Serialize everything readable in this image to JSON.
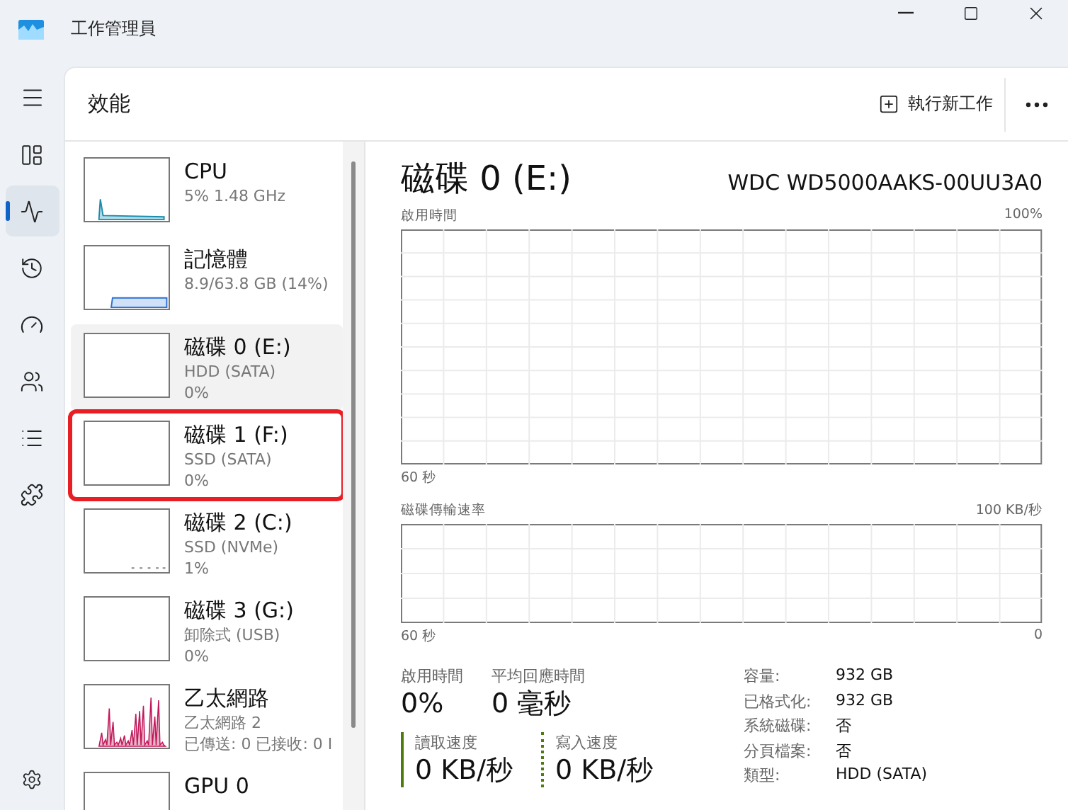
{
  "window": {
    "title": "工作管理員"
  },
  "nav": [
    {
      "kind": "processes",
      "selected": false
    },
    {
      "kind": "performance",
      "selected": true
    },
    {
      "kind": "history",
      "selected": false
    },
    {
      "kind": "startup",
      "selected": false
    },
    {
      "kind": "users",
      "selected": false
    },
    {
      "kind": "details",
      "selected": false
    },
    {
      "kind": "services",
      "selected": false
    }
  ],
  "header": {
    "title": "效能",
    "run_task": "執行新工作"
  },
  "devices": [
    {
      "kind": "cpu",
      "name": "CPU",
      "line1": "5% 1.48 GHz",
      "selected": false,
      "highlighted": false
    },
    {
      "kind": "memory",
      "name": "記憶體",
      "line1": "8.9/63.8 GB (14%)",
      "selected": false,
      "highlighted": false
    },
    {
      "kind": "disk",
      "name": "磁碟 0 (E:)",
      "line1": "HDD (SATA)",
      "line2": "0%",
      "selected": true,
      "highlighted": false
    },
    {
      "kind": "disk",
      "name": "磁碟 1 (F:)",
      "line1": "SSD (SATA)",
      "line2": "0%",
      "selected": false,
      "highlighted": true
    },
    {
      "kind": "disk-active",
      "name": "磁碟 2 (C:)",
      "line1": "SSD (NVMe)",
      "line2": "1%",
      "selected": false,
      "highlighted": false
    },
    {
      "kind": "disk",
      "name": "磁碟 3 (G:)",
      "line1": "卸除式 (USB)",
      "line2": "0%",
      "selected": false,
      "highlighted": false
    },
    {
      "kind": "network",
      "name": "乙太網路",
      "line1": "乙太網路 2",
      "line2": "已傳送: 0 已接收: 0 I",
      "selected": false,
      "highlighted": false
    },
    {
      "kind": "gpu",
      "name": "GPU 0",
      "selected": false,
      "highlighted": false
    }
  ],
  "detail": {
    "title": "磁碟 0 (E:)",
    "model": "WDC WD5000AAKS-00UU3A0",
    "charts": [
      {
        "label": "啟用時間",
        "max": "100%",
        "time": "60 秒"
      },
      {
        "label": "磁碟傳輸速率",
        "max": "100 KB/秒",
        "time": "60 秒",
        "min": "0"
      }
    ],
    "stats": [
      {
        "label": "啟用時間",
        "value": "0%"
      },
      {
        "label": "平均回應時間",
        "value": "0 毫秒"
      }
    ],
    "speeds": [
      {
        "kind": "read",
        "label": "讀取速度",
        "value": "0 KB/秒"
      },
      {
        "kind": "write",
        "label": "寫入速度",
        "value": "0 KB/秒"
      }
    ],
    "properties": [
      {
        "label": "容量:",
        "value": "932 GB"
      },
      {
        "label": "已格式化:",
        "value": "932 GB"
      },
      {
        "label": "系統磁碟:",
        "value": "否"
      },
      {
        "label": "分頁檔案:",
        "value": "否"
      },
      {
        "label": "類型:",
        "value": "HDD (SATA)"
      }
    ]
  }
}
